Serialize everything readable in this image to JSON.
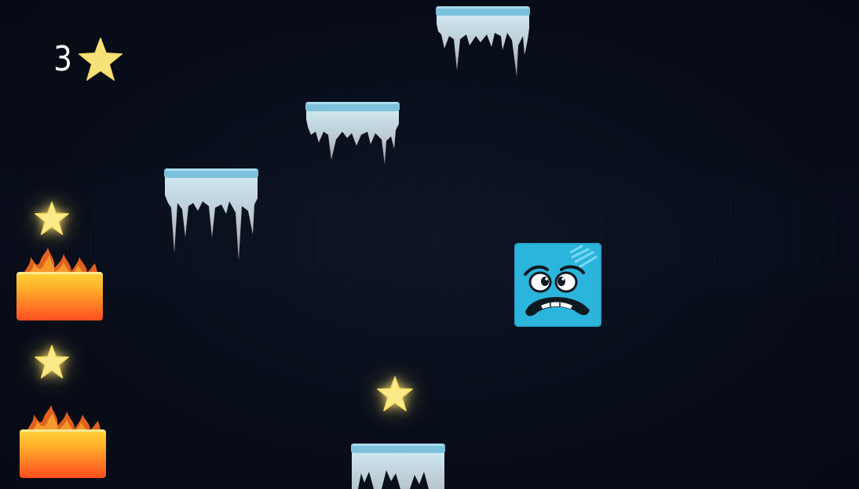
{
  "hud": {
    "star_count": "3",
    "star_icon": "star-icon"
  },
  "colors": {
    "background": "#080d19",
    "star": "#f7e27a",
    "ice_top": "#7cc2dc",
    "fire_box_top": "#ffd23a",
    "fire_box_bottom": "#ff4d1e",
    "hero": "#2bb4dc"
  },
  "player": {
    "expression": "scared"
  },
  "icons": [
    "star-icon",
    "ice-platform-icon",
    "fire-block-icon",
    "scared-face-icon"
  ]
}
